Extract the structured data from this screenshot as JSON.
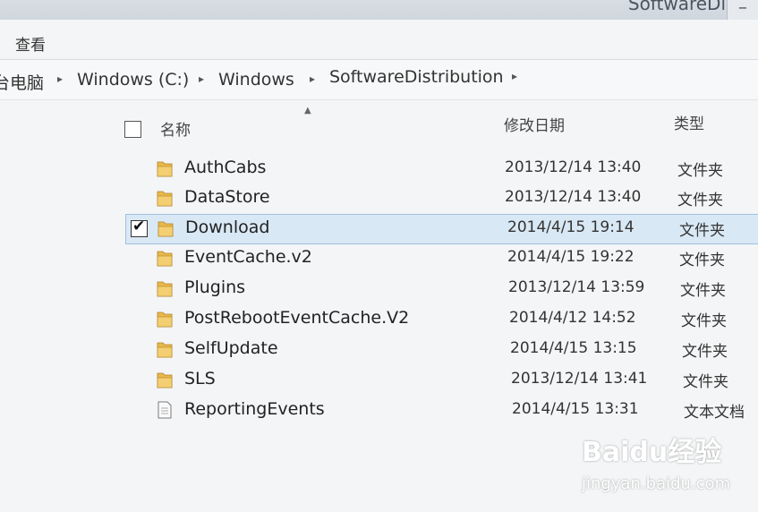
{
  "window": {
    "title": "SoftwareDi",
    "minimize_glyph": "−"
  },
  "ribbon": {
    "tab_view": "查看"
  },
  "address": {
    "crumbs": [
      "台电脑",
      "Windows (C:)",
      "Windows",
      "SoftwareDistribution"
    ],
    "separator": "▸"
  },
  "columns": {
    "name": "名称",
    "date": "修改日期",
    "type": "类型",
    "sort_indicator": "▲"
  },
  "files": [
    {
      "name": "AuthCabs",
      "date": "2013/12/14 13:40",
      "type": "文件夹",
      "icon": "folder-icon",
      "checked": false
    },
    {
      "name": "DataStore",
      "date": "2013/12/14 13:40",
      "type": "文件夹",
      "icon": "folder-icon",
      "checked": false
    },
    {
      "name": "Download",
      "date": "2014/4/15 19:14",
      "type": "文件夹",
      "icon": "folder-icon",
      "checked": true
    },
    {
      "name": "EventCache.v2",
      "date": "2014/4/15 19:22",
      "type": "文件夹",
      "icon": "folder-icon",
      "checked": false
    },
    {
      "name": "Plugins",
      "date": "2013/12/14 13:59",
      "type": "文件夹",
      "icon": "folder-icon",
      "checked": false
    },
    {
      "name": "PostRebootEventCache.V2",
      "date": "2014/4/12 14:52",
      "type": "文件夹",
      "icon": "folder-icon",
      "checked": false
    },
    {
      "name": "SelfUpdate",
      "date": "2014/4/15 13:15",
      "type": "文件夹",
      "icon": "folder-icon",
      "checked": false
    },
    {
      "name": "SLS",
      "date": "2013/12/14 13:41",
      "type": "文件夹",
      "icon": "folder-icon",
      "checked": false
    },
    {
      "name": "ReportingEvents",
      "date": "2014/4/15 13:31",
      "type": "文本文档",
      "icon": "text-document-icon",
      "checked": false
    }
  ],
  "checkmark": "✔",
  "watermark": {
    "logo": "Baidu经验",
    "url": "jingyan.baidu.com"
  },
  "colors": {
    "folder": "#e8b84a",
    "selected_row": "#d9e8f5",
    "selected_border": "#9fc2df"
  }
}
